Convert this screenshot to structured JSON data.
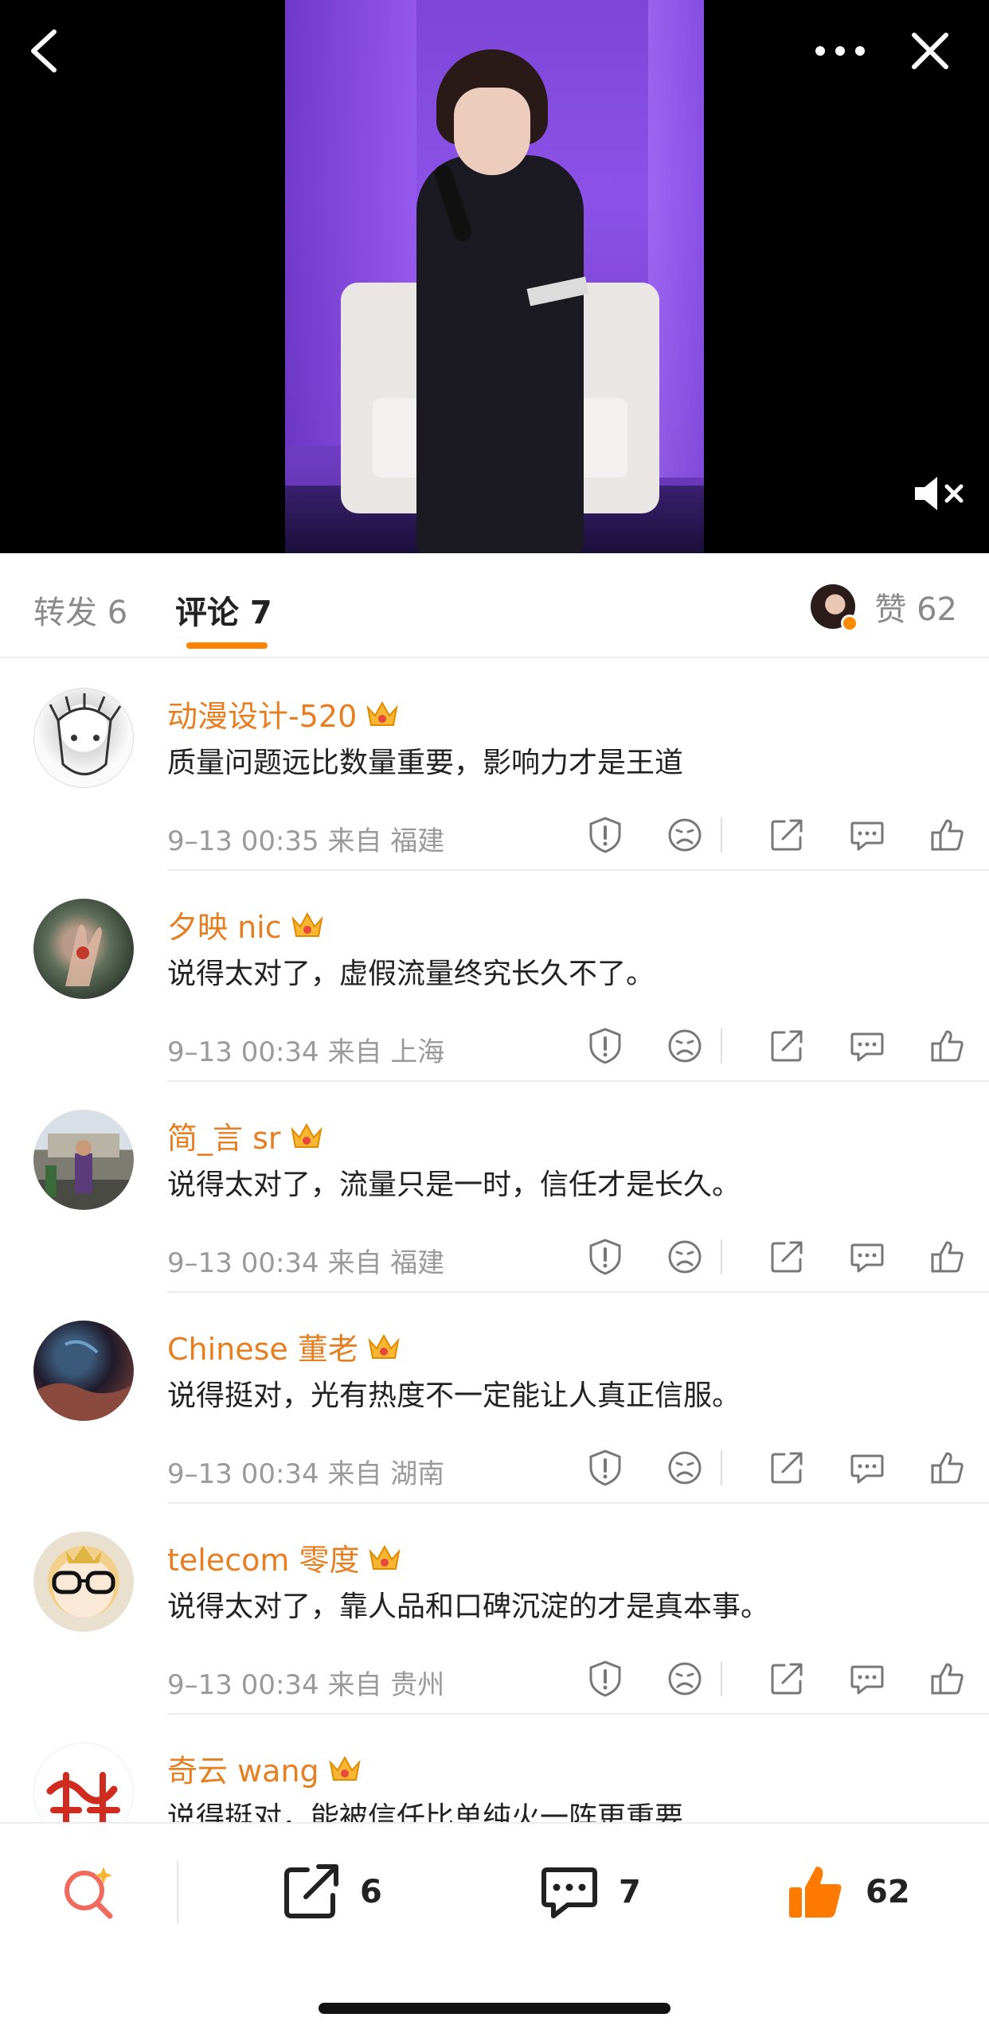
{
  "video": {
    "controls": {
      "back_icon": "chevron-left-icon",
      "more_icon": "more-dots-icon",
      "close_icon": "close-icon",
      "mute_icon": "speaker-muted-icon"
    }
  },
  "tabs": {
    "repost": "转发 6",
    "comment": "评论 7",
    "like_label": "赞 62"
  },
  "comments": [
    {
      "name": "动漫设计-520",
      "text": "质量问题远比数量重要，影响力才是王道",
      "meta": "9–13 00:35 来自 福建"
    },
    {
      "name": "夕映 nic",
      "text": "说得太对了，虚假流量终究长久不了。",
      "meta": "9–13 00:34 来自 上海"
    },
    {
      "name": "简_言 sr",
      "text": "说得太对了，流量只是一时，信任才是长久。",
      "meta": "9–13 00:34 来自 福建"
    },
    {
      "name": "Chinese 董老",
      "text": "说得挺对，光有热度不一定能让人真正信服。",
      "meta": "9–13 00:34 来自 湖南"
    },
    {
      "name": "telecom 零度",
      "text": "说得太对了，靠人品和口碑沉淀的才是真本事。",
      "meta": "9–13 00:34 来自 贵州"
    },
    {
      "name": "奇云 wang",
      "text": "说得挺对，能被信任比单纯火一阵更重要",
      "meta": ""
    }
  ],
  "bottom_bar": {
    "repost_count": "6",
    "comment_count": "7",
    "like_count": "62"
  },
  "colors": {
    "accent": "#ff8200",
    "username": "#e67e22",
    "like": "#ff7a00"
  }
}
